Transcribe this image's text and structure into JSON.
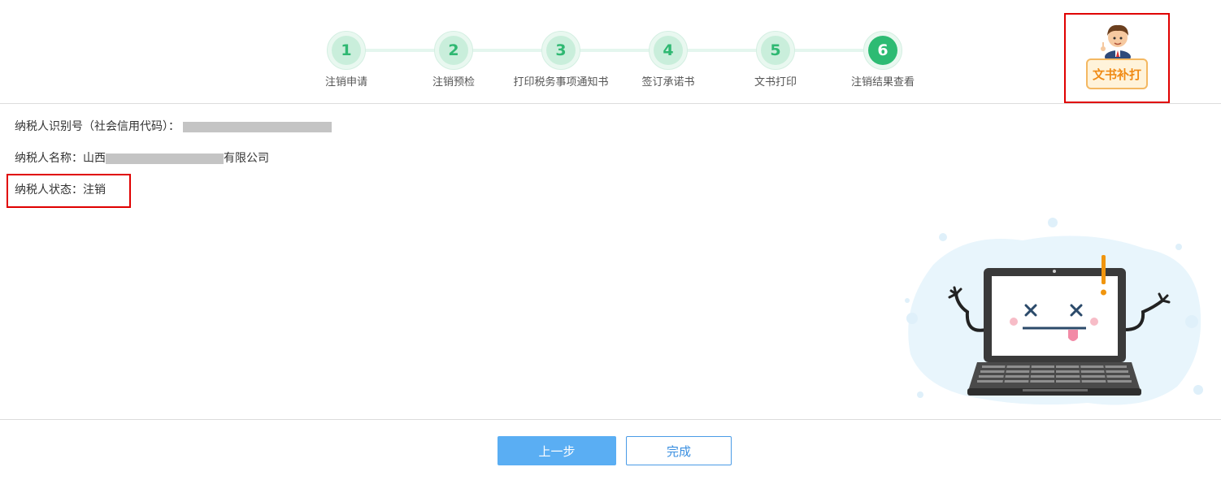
{
  "steps": [
    {
      "number": "1",
      "label": "注销申请"
    },
    {
      "number": "2",
      "label": "注销预检"
    },
    {
      "number": "3",
      "label": "打印税务事项通知书"
    },
    {
      "number": "4",
      "label": "签订承诺书"
    },
    {
      "number": "5",
      "label": "文书打印"
    },
    {
      "number": "6",
      "label": "注销结果查看"
    }
  ],
  "active_step": 6,
  "reprint": {
    "label": "文书补打"
  },
  "info": {
    "taxpayer_id_label": "纳税人识别号（社会信用代码）：",
    "taxpayer_name_label": "纳税人名称：",
    "taxpayer_name_prefix": "山西",
    "taxpayer_name_suffix": "有限公司",
    "status_label": "纳税人状态：",
    "status_value": "注销"
  },
  "buttons": {
    "prev": "上一步",
    "done": "完成"
  },
  "colors": {
    "step_active": "#2dbb73",
    "primary": "#5aaef3",
    "highlight": "#e00000",
    "reprint_accent": "#f08a14"
  }
}
